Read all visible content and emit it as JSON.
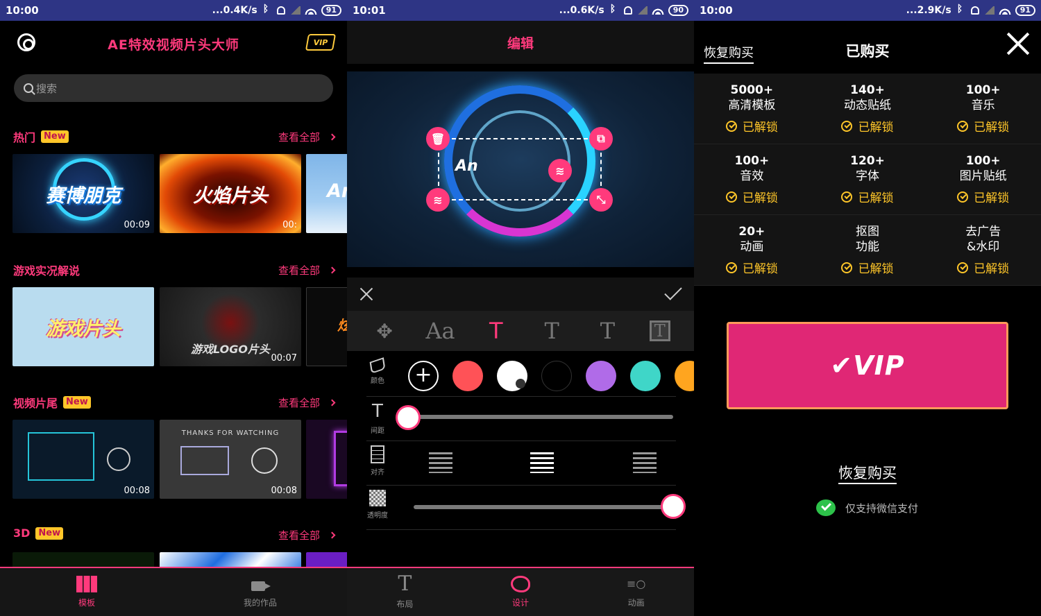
{
  "status_bars": [
    {
      "time": "10:00",
      "speed": "...0.4K/s",
      "battery": "91"
    },
    {
      "time": "10:01",
      "speed": "...0.6K/s",
      "battery": "90"
    },
    {
      "time": "10:00",
      "speed": "...2.9K/s",
      "battery": "91"
    }
  ],
  "home": {
    "title": "AE特效视频片头大师",
    "vip_label": "VIP",
    "search_placeholder": "搜索",
    "see_all": "查看全部",
    "new_tag": "New",
    "sections": [
      {
        "title": "热门",
        "new": true,
        "thumbs": [
          {
            "caption": "赛博朋克",
            "duration": "00:09"
          },
          {
            "caption": "火焰片头",
            "duration": "00:"
          },
          {
            "caption": "An",
            "duration": ""
          }
        ]
      },
      {
        "title": "游戏实况解说",
        "new": false,
        "thumbs": [
          {
            "caption": "游戏片头",
            "duration": ""
          },
          {
            "caption": "游戏LOGO片头",
            "duration": "00:07"
          },
          {
            "caption": "炫",
            "duration": ""
          }
        ]
      },
      {
        "title": "视频片尾",
        "new": true,
        "thumbs": [
          {
            "caption": "",
            "duration": "00:08"
          },
          {
            "caption": "THANKS FOR WATCHING",
            "duration": "00:08"
          },
          {
            "caption": "",
            "duration": ""
          }
        ]
      },
      {
        "title": "3D",
        "new": true,
        "thumbs": []
      }
    ],
    "nav": [
      {
        "label": "模板",
        "active": true
      },
      {
        "label": "我的作品",
        "active": false
      }
    ]
  },
  "editor": {
    "title": "编辑",
    "preview_text": "An",
    "tools": [
      "✥",
      "Aa",
      "T",
      "T",
      "T",
      "T"
    ],
    "rows": {
      "color_label": "颜色",
      "spacing_label": "间距",
      "align_label": "对齐",
      "opacity_label": "透明度"
    },
    "swatches": [
      "#ff5257",
      "#ffffff",
      "#000000",
      "#b06be8",
      "#3fd6c8",
      "#ffa51f"
    ],
    "spacing_value": 0.0,
    "opacity_value": 1.0,
    "nav": [
      {
        "label": "布局",
        "active": false
      },
      {
        "label": "设计",
        "active": true
      },
      {
        "label": "动画",
        "active": false
      }
    ]
  },
  "purchase": {
    "restore_top": "恢复购买",
    "title": "已购买",
    "features": [
      {
        "num": "5000+",
        "label": "高清模板",
        "unlocked": "已解锁"
      },
      {
        "num": "140+",
        "label": "动态贴纸",
        "unlocked": "已解锁"
      },
      {
        "num": "100+",
        "label": "音乐",
        "unlocked": "已解锁"
      },
      {
        "num": "100+",
        "label": "音效",
        "unlocked": "已解锁"
      },
      {
        "num": "120+",
        "label": "字体",
        "unlocked": "已解锁"
      },
      {
        "num": "100+",
        "label": "图片贴纸",
        "unlocked": "已解锁"
      },
      {
        "num": "20+",
        "label": "动画",
        "unlocked": "已解锁"
      },
      {
        "num": "抠图",
        "label": "功能",
        "unlocked": "已解锁"
      },
      {
        "num": "去广告",
        "label": "&水印",
        "unlocked": "已解锁"
      }
    ],
    "vip_button": "✔VIP",
    "restore_mid": "恢复购买",
    "wechat_note": "仅支持微信支付"
  },
  "colors": {
    "accent": "#ff3a7c",
    "gold": "#ffc629",
    "statusbar": "#2e3585"
  }
}
